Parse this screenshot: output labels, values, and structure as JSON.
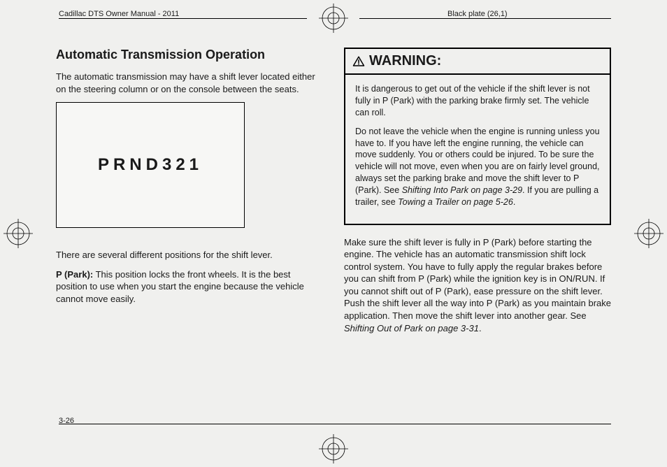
{
  "header": {
    "left": "Cadillac DTS Owner Manual - 2011",
    "right": "Black plate (26,1)"
  },
  "page_number": "3-26",
  "left_column": {
    "heading": "Automatic Transmission Operation",
    "intro": "The automatic transmission may have a shift lever located either on the steering column or on the console between the seats.",
    "figure_label": "PRND321",
    "positions_text": "There are several different positions for the shift lever.",
    "p_park_label": "P (Park):",
    "p_park_text": " This position locks the front wheels. It is the best position to use when you start the engine because the vehicle cannot move easily."
  },
  "warning": {
    "title": "WARNING:",
    "p1": "It is dangerous to get out of the vehicle if the shift lever is not fully in P (Park) with the parking brake firmly set. The vehicle can roll.",
    "p2_a": "Do not leave the vehicle when the engine is running unless you have to. If you have left the engine running, the vehicle can move suddenly. You or others could be injured. To be sure the vehicle will not move, even when you are on fairly level ground, always set the parking brake and move the shift lever to P (Park). See ",
    "p2_ref1": "Shifting Into Park  on page 3‑29",
    "p2_b": ". If you are pulling a trailer, see ",
    "p2_ref2": "Towing a Trailer on page 5‑26",
    "p2_c": "."
  },
  "right_para": {
    "a": "Make sure the shift lever is fully in P (Park) before starting the engine. The vehicle has an automatic transmission shift lock control system. You have to fully apply the regular brakes before you can shift from P (Park) while the ignition key is in ON/RUN. If you cannot shift out of P (Park), ease pressure on the shift lever. Push the shift lever all the way into P (Park) as you maintain brake application. Then move the shift lever into another gear. See ",
    "ref": "Shifting Out of Park on page 3‑31",
    "b": "."
  }
}
